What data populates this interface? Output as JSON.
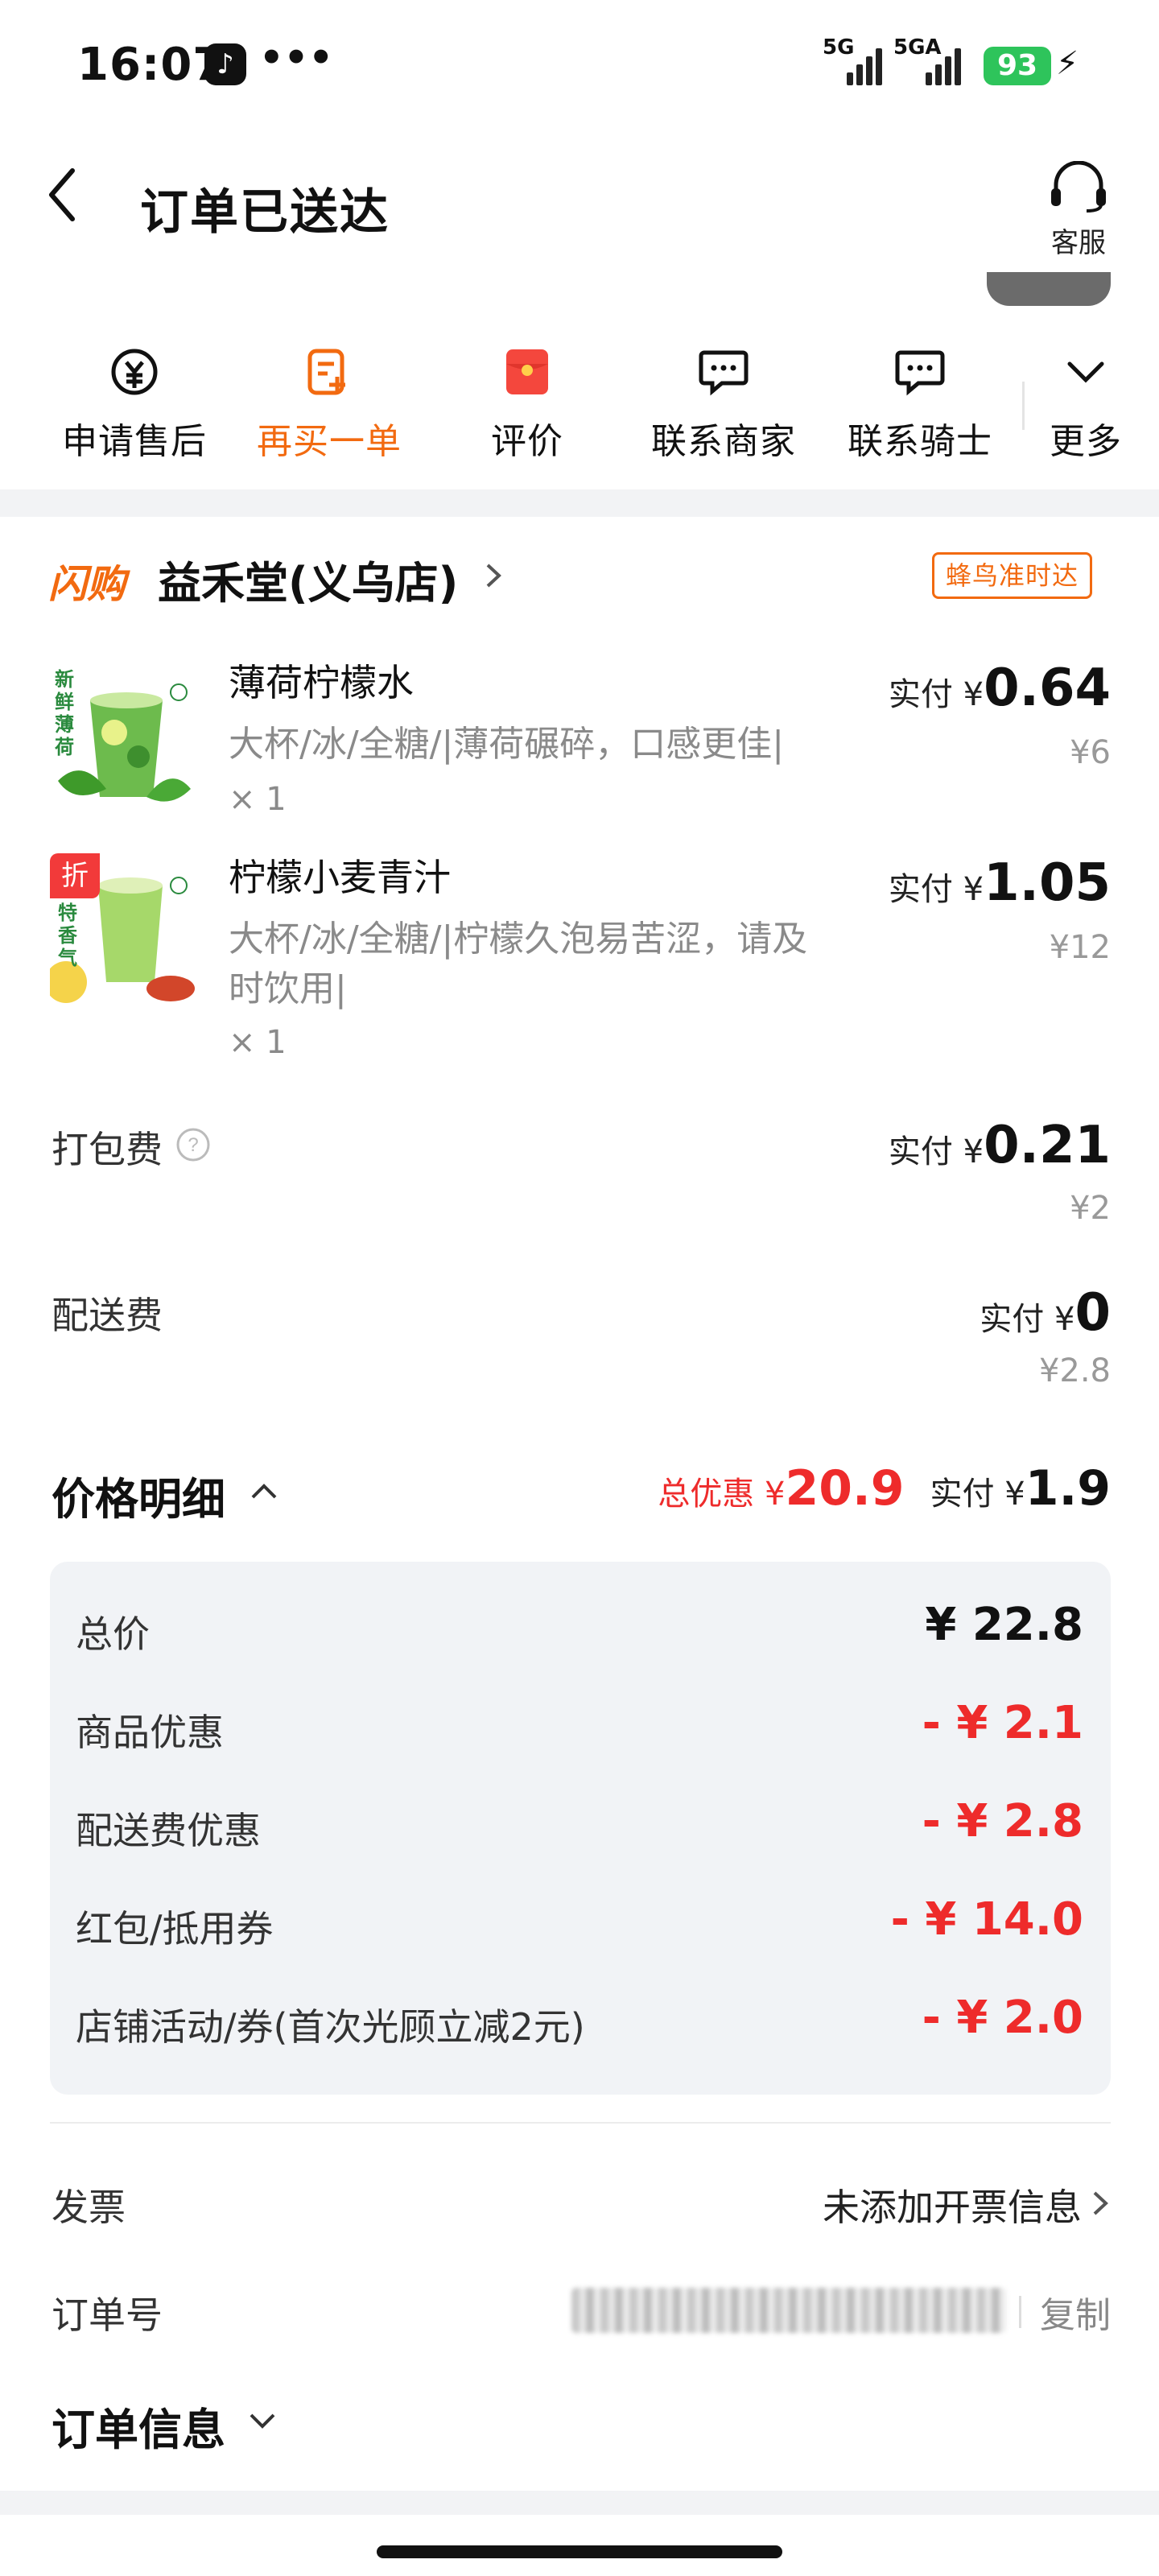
{
  "status_bar": {
    "time": "16:07",
    "dots": "•••",
    "net1": "5G",
    "net2": "5GA",
    "battery": "93"
  },
  "header": {
    "title": "订单已送达",
    "service_label": "客服"
  },
  "actions": [
    {
      "label": "申请售后",
      "icon": "refund-icon"
    },
    {
      "label": "再买一单",
      "icon": "reorder-icon"
    },
    {
      "label": "评价",
      "icon": "red-packet-icon"
    },
    {
      "label": "联系商家",
      "icon": "chat-icon"
    },
    {
      "label": "联系骑士",
      "icon": "chat-icon"
    },
    {
      "label": "更多",
      "icon": "chevron-down-icon"
    }
  ],
  "shop": {
    "tag": "闪购",
    "name": "益禾堂(义乌店)",
    "badge": "蜂鸟准时达"
  },
  "items": [
    {
      "name": "薄荷柠檬水",
      "desc": "大杯/冰/全糖/|薄荷碾碎，口感更佳|",
      "qty": "× 1",
      "pay_label": "实付 ¥",
      "pay": "0.64",
      "orig": "¥6",
      "img_text": "新鲜薄荷"
    },
    {
      "name": "柠檬小麦青汁",
      "desc": "大杯/冰/全糖/|柠檬久泡易苦涩，请及时饮用|",
      "qty": "× 1",
      "pay_label": "实付 ¥",
      "pay": "1.05",
      "orig": "¥12",
      "img_text": "特香气",
      "discount": "折"
    }
  ],
  "fees": [
    {
      "label": "打包费",
      "pay_label": "实付 ¥",
      "pay": "0.21",
      "orig": "¥2"
    },
    {
      "label": "配送费",
      "pay_label": "实付 ¥",
      "pay": "0",
      "orig": "¥2.8"
    }
  ],
  "price_detail": {
    "title": "价格明细",
    "discount_label": "总优惠 ¥",
    "discount": "20.9",
    "pay_label": "实付 ¥",
    "pay": "1.9",
    "rows": [
      {
        "label": "总价",
        "value": "¥ 22.8"
      },
      {
        "label": "商品优惠",
        "value": "- ¥ 2.1"
      },
      {
        "label": "配送费优惠",
        "value": "- ¥ 2.8"
      },
      {
        "label": "红包/抵用券",
        "value": "- ¥ 14.0"
      },
      {
        "label": "店铺活动/券(首次光顾立减2元)",
        "value": "- ¥ 2.0"
      }
    ]
  },
  "invoice": {
    "label": "发票",
    "value": "未添加开票信息"
  },
  "order_no": {
    "label": "订单号",
    "copy": "复制"
  },
  "order_info": {
    "label": "订单信息"
  },
  "colors": {
    "accent": "#f26a10",
    "red": "#ee2b2b",
    "battery": "#2ec45b"
  }
}
